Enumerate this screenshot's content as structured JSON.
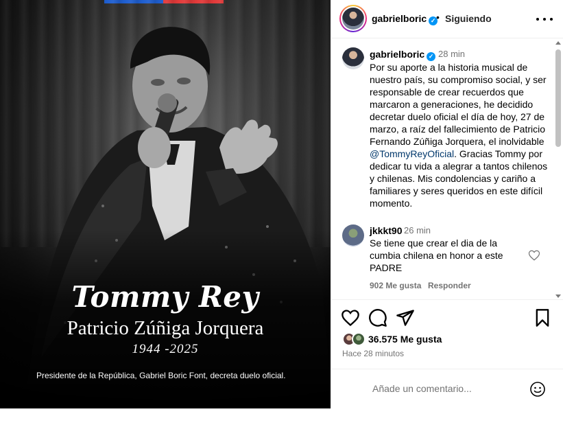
{
  "photo": {
    "name": "Tommy Rey",
    "full_name": "Patricio Zúñiga Jorquera",
    "years": "1944 -2025",
    "caption": "Presidente de la República, Gabriel Boric Font, decreta duelo oficial."
  },
  "header": {
    "username": "gabrielboric",
    "separator": "•",
    "follow_status": "Siguiendo"
  },
  "caption": {
    "username": "gabrielboric",
    "time": "28 min",
    "text_before": "Por su aporte a la historia musical de nuestro país, su compromiso social, y ser responsable de crear recuerdos que marcaron a generaciones, he decidido decretar duelo oficial el día de hoy, 27 de marzo, a raíz del fallecimiento de Patricio Fernando Zúñiga Jorquera, el inolvidable ",
    "mention": "@TommyReyOficial",
    "text_after": ". Gracias Tommy por dedicar tu vida a alegrar a tantos chilenos y chilenas. Mis condolencias y cariño a familiares y seres queridos en este difícil momento."
  },
  "comment": {
    "username": "jkkkt90",
    "time": "26 min",
    "text": "Se tiene que crear el dia de la cumbia chilena en honor a este PADRE",
    "likes": "902 Me gusta",
    "reply": "Responder"
  },
  "post": {
    "likes": "36.575 Me gusta",
    "time": "Hace 28 minutos"
  },
  "add_comment": {
    "placeholder": "Añade un comentario..."
  },
  "colors": {
    "verified": "#0095f6",
    "mention": "#00376b",
    "secondary_text": "#737373",
    "flag_blue": "#1f5fd0",
    "flag_red": "#e23a3a"
  },
  "icons": [
    "more-options-icon",
    "heart-icon",
    "comment-icon",
    "share-icon",
    "bookmark-icon",
    "emoji-icon",
    "verified-badge-icon"
  ]
}
